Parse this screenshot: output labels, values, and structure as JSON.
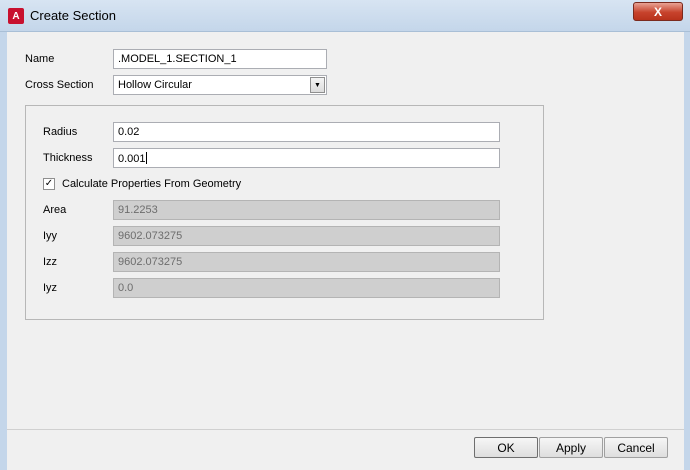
{
  "window": {
    "title": "Create Section",
    "close_glyph": "X",
    "icon": "A"
  },
  "form": {
    "name_label": "Name",
    "name_value": ".MODEL_1.SECTION_1",
    "cross_section_label": "Cross Section",
    "cross_section_value": "Hollow Circular"
  },
  "geometry": {
    "radius_label": "Radius",
    "radius_value": "0.02",
    "thickness_label": "Thickness",
    "thickness_value": "0.001",
    "calc_props_label": "Calculate Properties From Geometry",
    "calc_props_checked": true
  },
  "properties": {
    "area_label": "Area",
    "area_value": "91.2253",
    "iyy_label": "Iyy",
    "iyy_value": "9602.073275",
    "izz_label": "Izz",
    "izz_value": "9602.073275",
    "iyz_label": "Iyz",
    "iyz_value": "0.0"
  },
  "buttons": {
    "ok": "OK",
    "apply": "Apply",
    "cancel": "Cancel"
  }
}
